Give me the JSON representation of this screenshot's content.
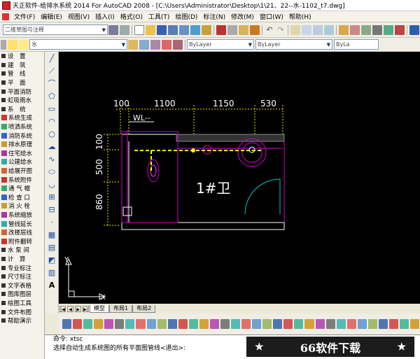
{
  "window": {
    "title": "天正软件-给排水系统 2014 For AutoCAD 2008 - [C:\\Users\\Administrator\\Desktop\\1\\21、22--水-1102_t7.dwg]"
  },
  "menu": [
    "文件(F)",
    "编辑(E)",
    "视图(V)",
    "插入(I)",
    "格式(O)",
    "工具(T)",
    "绘图(D)",
    "标注(N)",
    "修改(M)",
    "窗口(W)",
    "帮助(H)"
  ],
  "toolbar": {
    "workspace_value": "二维草图与注释",
    "layer_value": "水",
    "color_value": "ByLayer",
    "linetype_value": "ByLayer",
    "lineweight_value": "ByLa"
  },
  "sidebar": {
    "items": [
      {
        "label": "设　置",
        "kind": "cat"
      },
      {
        "label": "建　筑",
        "kind": "cat"
      },
      {
        "label": "管　线",
        "kind": "cat"
      },
      {
        "label": "平　面",
        "kind": "cat"
      },
      {
        "label": "平面消防",
        "kind": "cat"
      },
      {
        "label": "虹吸雨水",
        "kind": "cat"
      },
      {
        "label": "系　统",
        "kind": "cat"
      },
      {
        "label": "系统生成",
        "kind": "tool"
      },
      {
        "label": "喷洒系统",
        "kind": "tool"
      },
      {
        "label": "消防系统",
        "kind": "tool"
      },
      {
        "label": "排水原理",
        "kind": "tool"
      },
      {
        "label": "住宅给水",
        "kind": "tool"
      },
      {
        "label": "公建给水",
        "kind": "tool"
      },
      {
        "label": "给展开图",
        "kind": "tool"
      },
      {
        "label": "系统附件",
        "kind": "tool"
      },
      {
        "label": "通 气 帽",
        "kind": "tool"
      },
      {
        "label": "检 查 口",
        "kind": "tool"
      },
      {
        "label": "消 火 栓",
        "kind": "tool"
      },
      {
        "label": "系统缩放",
        "kind": "tool"
      },
      {
        "label": "管线延长",
        "kind": "tool"
      },
      {
        "label": "改楼层线",
        "kind": "tool"
      },
      {
        "label": "附件翻转",
        "kind": "tool"
      },
      {
        "label": "水 泵 间",
        "kind": "cat"
      },
      {
        "label": "计　算",
        "kind": "cat"
      },
      {
        "label": "专业标注",
        "kind": "cat"
      },
      {
        "label": "尺寸标注",
        "kind": "cat"
      },
      {
        "label": "文字表格",
        "kind": "cat"
      },
      {
        "label": "图库图层",
        "kind": "cat"
      },
      {
        "label": "绘图工具",
        "kind": "cat"
      },
      {
        "label": "文件布图",
        "kind": "cat"
      },
      {
        "label": "帮助演示",
        "kind": "cat"
      }
    ]
  },
  "drawing": {
    "dimensions": [
      "100",
      "1100",
      "1150",
      "530"
    ],
    "vertical_dimensions": [
      "100",
      "500",
      "860"
    ],
    "pipe_label": "WL--",
    "room_label": "1#卫",
    "axis_y": "Y",
    "axis_x": "X"
  },
  "tabs": [
    "模型",
    "布局1",
    "布局2"
  ],
  "command": {
    "line1": "命令: xtsc",
    "line2": "选择自动生成系统图的所有平面图管线<退出>:"
  },
  "watermark": {
    "star": "★",
    "text": "66软件下载"
  }
}
